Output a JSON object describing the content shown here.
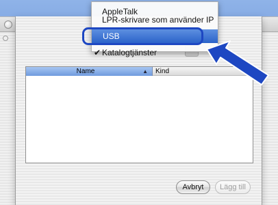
{
  "popup_menu": {
    "items": [
      {
        "label": "AppleTalk",
        "checked": false,
        "selected": false
      },
      {
        "label": "LPR-skrivare som använder IP",
        "checked": false,
        "selected": false
      },
      {
        "label": "USB",
        "checked": false,
        "selected": true
      },
      {
        "label": "Katalogtjänster",
        "checked": true,
        "selected": false
      }
    ],
    "checkmark": "✔"
  },
  "printer_list": {
    "columns": [
      {
        "label": "Name",
        "sorted": true,
        "sort_glyph": "▲"
      },
      {
        "label": "Kind",
        "sorted": false
      }
    ],
    "rows": []
  },
  "buttons": {
    "cancel_label": "Avbryt",
    "add_label": "Lägg till"
  },
  "colors": {
    "callout_arrow": "#1d47c2",
    "selection": "#2b63c9"
  }
}
